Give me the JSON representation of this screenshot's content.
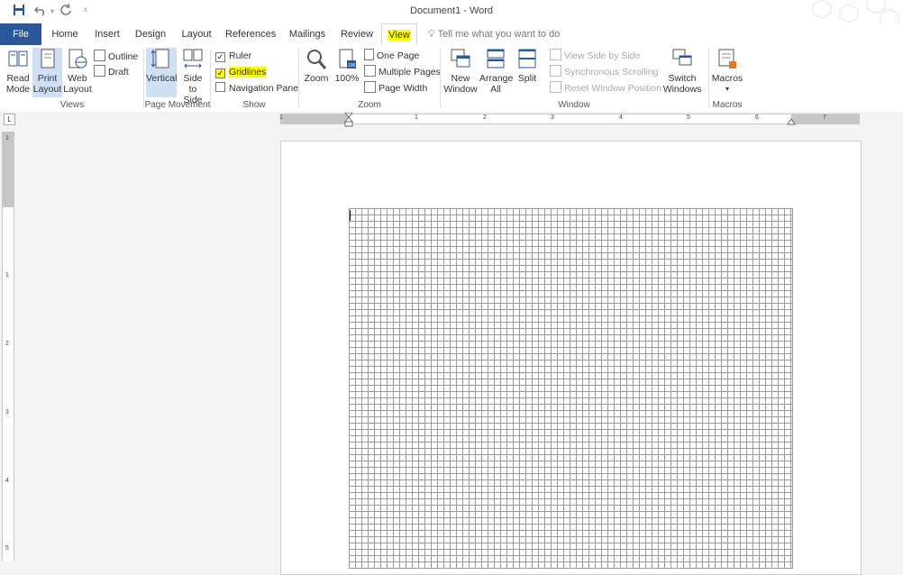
{
  "window": {
    "title": "Document1 - Word"
  },
  "tabs": [
    {
      "label": "File"
    },
    {
      "label": "Home"
    },
    {
      "label": "Insert"
    },
    {
      "label": "Design"
    },
    {
      "label": "Layout"
    },
    {
      "label": "References"
    },
    {
      "label": "Mailings"
    },
    {
      "label": "Review"
    },
    {
      "label": "View"
    }
  ],
  "search": {
    "placeholder": "Tell me what you want to do"
  },
  "views": {
    "read_mode": "Read\nMode",
    "print_layout": "Print\nLayout",
    "web_layout": "Web\nLayout",
    "outline": "Outline",
    "draft": "Draft",
    "label": "Views"
  },
  "page_movement": {
    "vertical": "Vertical",
    "side_to_side": "Side\nto Side",
    "label": "Page Movement"
  },
  "show": {
    "ruler": "Ruler",
    "gridlines": "Gridlines",
    "navigation_pane": "Navigation Pane",
    "label": "Show",
    "ruler_checked": true,
    "gridlines_checked": true,
    "navigation_checked": false
  },
  "zoom": {
    "zoom": "Zoom",
    "hundred": "100%",
    "one_page": "One Page",
    "multiple_pages": "Multiple Pages",
    "page_width": "Page Width",
    "label": "Zoom"
  },
  "window_group": {
    "new_window": "New\nWindow",
    "arrange_all": "Arrange\nAll",
    "split": "Split",
    "view_side_by_side": "View Side by Side",
    "sync_scrolling": "Synchronous Scrolling",
    "reset_position": "Reset Window Position",
    "switch_windows": "Switch\nWindows",
    "label": "Window"
  },
  "macros": {
    "macros": "Macros",
    "label": "Macros"
  },
  "ruler": {
    "h_numbers": [
      "1",
      "1",
      "2",
      "3",
      "4",
      "5",
      "6",
      "7"
    ],
    "v_numbers": [
      "1",
      "1",
      "2",
      "3",
      "4",
      "5"
    ]
  }
}
